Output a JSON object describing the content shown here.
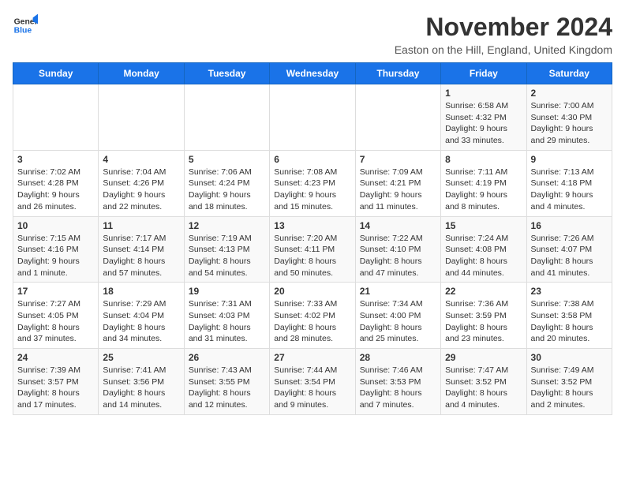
{
  "logo": {
    "general": "General",
    "blue": "Blue"
  },
  "title": "November 2024",
  "subtitle": "Easton on the Hill, England, United Kingdom",
  "days_of_week": [
    "Sunday",
    "Monday",
    "Tuesday",
    "Wednesday",
    "Thursday",
    "Friday",
    "Saturday"
  ],
  "weeks": [
    [
      {
        "day": "",
        "info": ""
      },
      {
        "day": "",
        "info": ""
      },
      {
        "day": "",
        "info": ""
      },
      {
        "day": "",
        "info": ""
      },
      {
        "day": "",
        "info": ""
      },
      {
        "day": "1",
        "info": "Sunrise: 6:58 AM\nSunset: 4:32 PM\nDaylight: 9 hours and 33 minutes."
      },
      {
        "day": "2",
        "info": "Sunrise: 7:00 AM\nSunset: 4:30 PM\nDaylight: 9 hours and 29 minutes."
      }
    ],
    [
      {
        "day": "3",
        "info": "Sunrise: 7:02 AM\nSunset: 4:28 PM\nDaylight: 9 hours and 26 minutes."
      },
      {
        "day": "4",
        "info": "Sunrise: 7:04 AM\nSunset: 4:26 PM\nDaylight: 9 hours and 22 minutes."
      },
      {
        "day": "5",
        "info": "Sunrise: 7:06 AM\nSunset: 4:24 PM\nDaylight: 9 hours and 18 minutes."
      },
      {
        "day": "6",
        "info": "Sunrise: 7:08 AM\nSunset: 4:23 PM\nDaylight: 9 hours and 15 minutes."
      },
      {
        "day": "7",
        "info": "Sunrise: 7:09 AM\nSunset: 4:21 PM\nDaylight: 9 hours and 11 minutes."
      },
      {
        "day": "8",
        "info": "Sunrise: 7:11 AM\nSunset: 4:19 PM\nDaylight: 9 hours and 8 minutes."
      },
      {
        "day": "9",
        "info": "Sunrise: 7:13 AM\nSunset: 4:18 PM\nDaylight: 9 hours and 4 minutes."
      }
    ],
    [
      {
        "day": "10",
        "info": "Sunrise: 7:15 AM\nSunset: 4:16 PM\nDaylight: 9 hours and 1 minute."
      },
      {
        "day": "11",
        "info": "Sunrise: 7:17 AM\nSunset: 4:14 PM\nDaylight: 8 hours and 57 minutes."
      },
      {
        "day": "12",
        "info": "Sunrise: 7:19 AM\nSunset: 4:13 PM\nDaylight: 8 hours and 54 minutes."
      },
      {
        "day": "13",
        "info": "Sunrise: 7:20 AM\nSunset: 4:11 PM\nDaylight: 8 hours and 50 minutes."
      },
      {
        "day": "14",
        "info": "Sunrise: 7:22 AM\nSunset: 4:10 PM\nDaylight: 8 hours and 47 minutes."
      },
      {
        "day": "15",
        "info": "Sunrise: 7:24 AM\nSunset: 4:08 PM\nDaylight: 8 hours and 44 minutes."
      },
      {
        "day": "16",
        "info": "Sunrise: 7:26 AM\nSunset: 4:07 PM\nDaylight: 8 hours and 41 minutes."
      }
    ],
    [
      {
        "day": "17",
        "info": "Sunrise: 7:27 AM\nSunset: 4:05 PM\nDaylight: 8 hours and 37 minutes."
      },
      {
        "day": "18",
        "info": "Sunrise: 7:29 AM\nSunset: 4:04 PM\nDaylight: 8 hours and 34 minutes."
      },
      {
        "day": "19",
        "info": "Sunrise: 7:31 AM\nSunset: 4:03 PM\nDaylight: 8 hours and 31 minutes."
      },
      {
        "day": "20",
        "info": "Sunrise: 7:33 AM\nSunset: 4:02 PM\nDaylight: 8 hours and 28 minutes."
      },
      {
        "day": "21",
        "info": "Sunrise: 7:34 AM\nSunset: 4:00 PM\nDaylight: 8 hours and 25 minutes."
      },
      {
        "day": "22",
        "info": "Sunrise: 7:36 AM\nSunset: 3:59 PM\nDaylight: 8 hours and 23 minutes."
      },
      {
        "day": "23",
        "info": "Sunrise: 7:38 AM\nSunset: 3:58 PM\nDaylight: 8 hours and 20 minutes."
      }
    ],
    [
      {
        "day": "24",
        "info": "Sunrise: 7:39 AM\nSunset: 3:57 PM\nDaylight: 8 hours and 17 minutes."
      },
      {
        "day": "25",
        "info": "Sunrise: 7:41 AM\nSunset: 3:56 PM\nDaylight: 8 hours and 14 minutes."
      },
      {
        "day": "26",
        "info": "Sunrise: 7:43 AM\nSunset: 3:55 PM\nDaylight: 8 hours and 12 minutes."
      },
      {
        "day": "27",
        "info": "Sunrise: 7:44 AM\nSunset: 3:54 PM\nDaylight: 8 hours and 9 minutes."
      },
      {
        "day": "28",
        "info": "Sunrise: 7:46 AM\nSunset: 3:53 PM\nDaylight: 8 hours and 7 minutes."
      },
      {
        "day": "29",
        "info": "Sunrise: 7:47 AM\nSunset: 3:52 PM\nDaylight: 8 hours and 4 minutes."
      },
      {
        "day": "30",
        "info": "Sunrise: 7:49 AM\nSunset: 3:52 PM\nDaylight: 8 hours and 2 minutes."
      }
    ]
  ]
}
